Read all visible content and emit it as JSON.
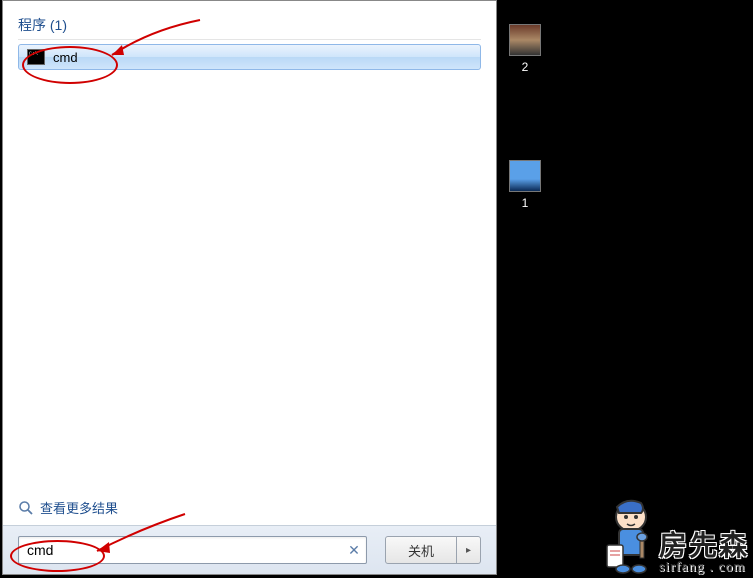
{
  "start_menu": {
    "section_header": "程序 (1)",
    "results": [
      {
        "label": "cmd"
      }
    ],
    "more_results": "查看更多结果",
    "search_value": "cmd",
    "shutdown_label": "关机",
    "shutdown_arrow": "▸"
  },
  "desktop": {
    "icon1_label": "2",
    "icon2_label": "1"
  },
  "watermark": {
    "main": "房先森",
    "sub": "sirfang . com"
  },
  "colors": {
    "link": "#1e4e8e",
    "highlight_border": "#8fb8e8",
    "annotation": "#d00000"
  }
}
